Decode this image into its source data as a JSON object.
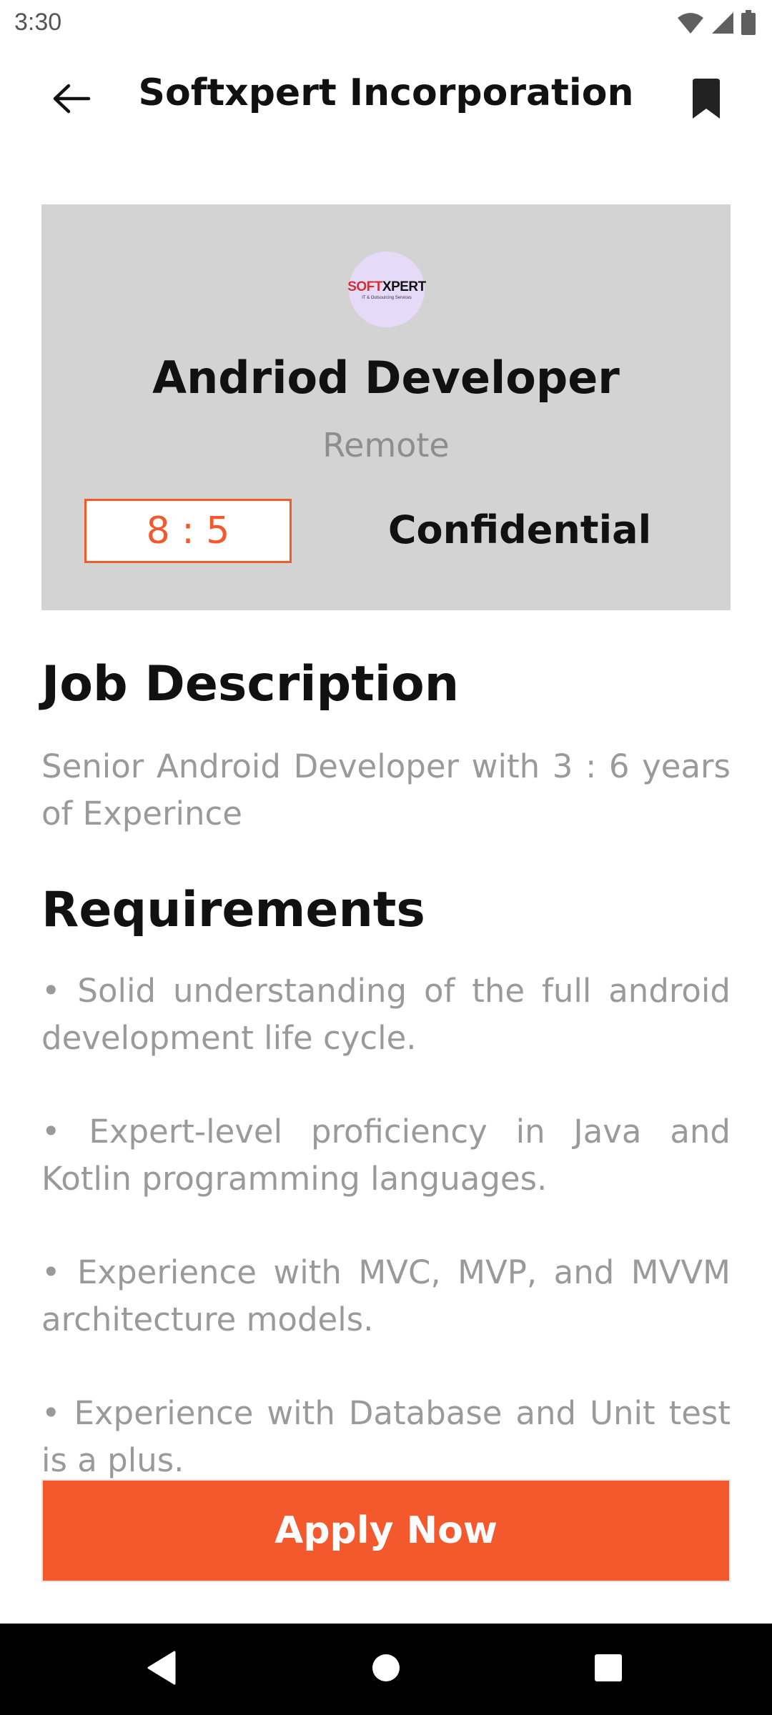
{
  "status_bar": {
    "time": "3:30",
    "icons": [
      "wifi-icon",
      "cellular-signal-icon",
      "battery-icon"
    ]
  },
  "header": {
    "title": "Softxpert Incorporation",
    "back_icon": "arrow-left-icon",
    "bookmark_icon": "bookmark-icon"
  },
  "job": {
    "company_logo": {
      "text_part1": "SOFT",
      "text_part2": "XPERT",
      "tagline": "IT & Outsourcing Services"
    },
    "title": "Andriod Developer",
    "location": "Remote",
    "hours": "8 : 5",
    "salary": "Confidential"
  },
  "description": {
    "heading": "Job Description",
    "text": "Senior Android Developer with 3 : 6 years of Experince"
  },
  "requirements": {
    "heading": "Requirements",
    "items": [
      "• Solid understanding of the full android development life cycle.",
      "• Expert-level proficiency in Java and Kotlin programming languages.",
      "• Experience with MVC, MVP, and MVVM architecture models.",
      "• Experience with Database and Unit test is a plus."
    ]
  },
  "apply_button": {
    "label": "Apply Now"
  },
  "nav_bar": {
    "icons": [
      "back-triangle-icon",
      "home-circle-icon",
      "recents-square-icon"
    ]
  },
  "colors": {
    "accent": "#f4592d",
    "card_background": "#d3d3d3",
    "muted_text": "#9a9a9a",
    "logo_background": "#e5dbf8"
  }
}
